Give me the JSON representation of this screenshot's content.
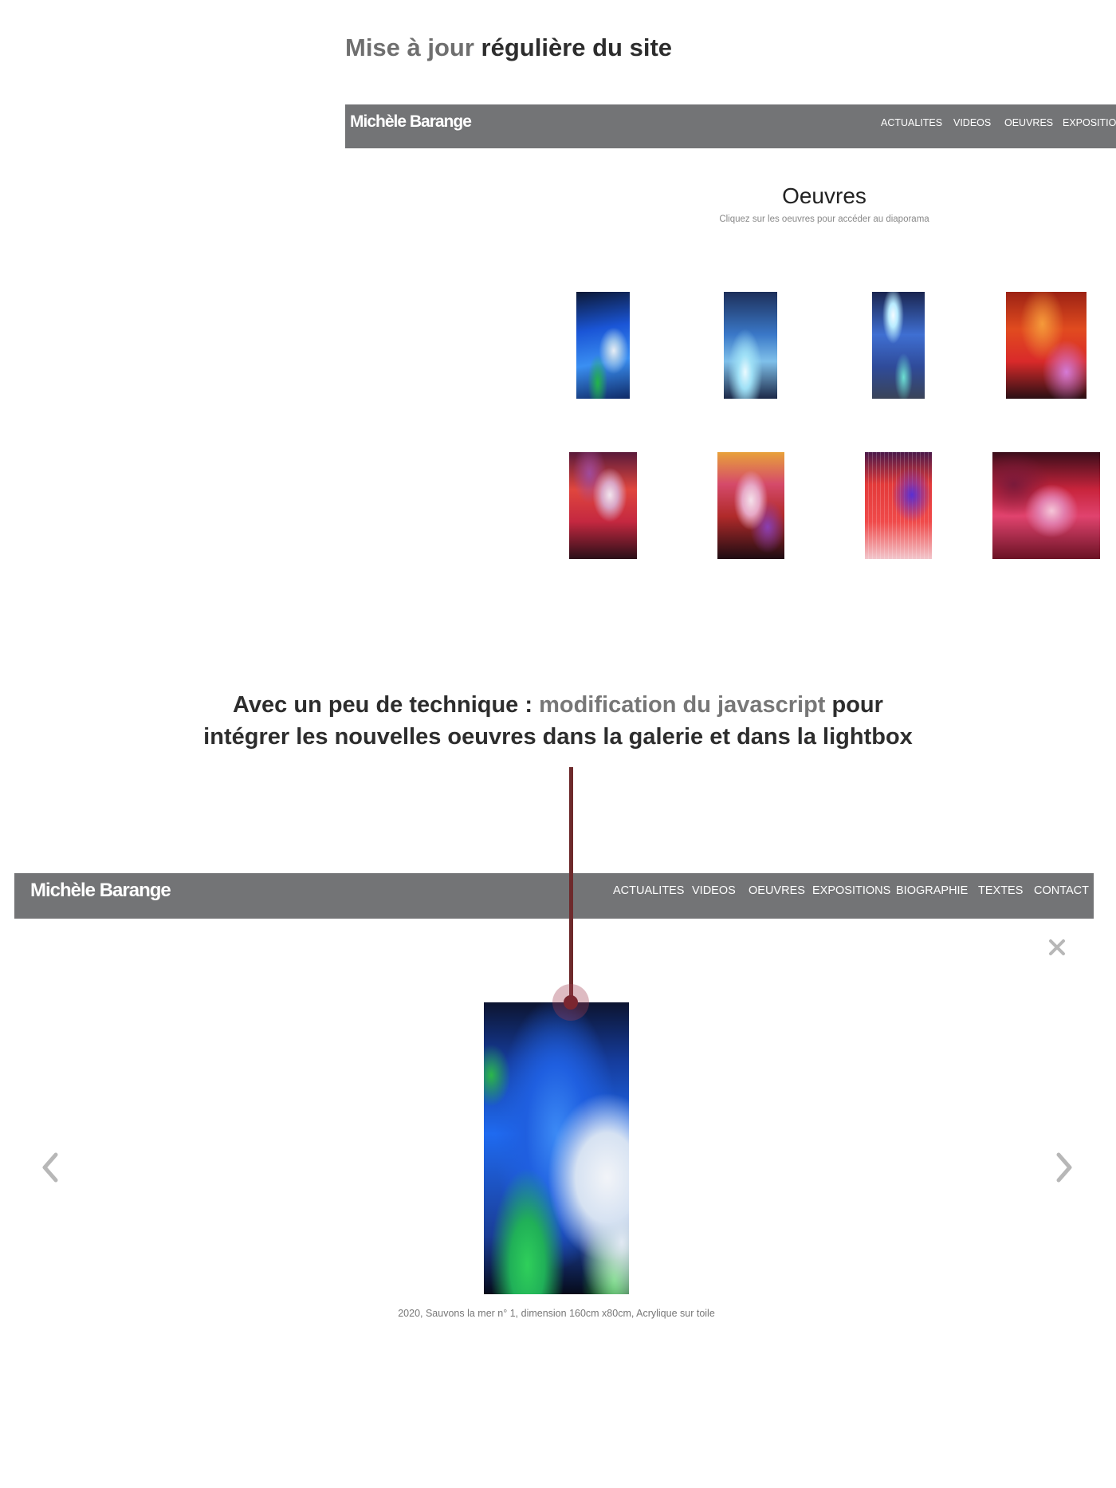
{
  "heading": {
    "accent": "Mise à jour",
    "rest": " régulière du site"
  },
  "site_top": {
    "brand": "Michèle Barange",
    "nav": [
      "ACTUALITES",
      "VIDEOS",
      "OEUVRES",
      "EXPOSITION"
    ]
  },
  "gallery": {
    "title": "Oeuvres",
    "subtitle": "Cliquez sur les oeuvres pour accéder au diaporama"
  },
  "annotation": {
    "part1": "Avec un peu de technique : ",
    "accent": "modification du javascript",
    "part2": " pour",
    "line2": "intégrer les nouvelles oeuvres dans la galerie et dans la lightbox"
  },
  "site_bottom": {
    "brand": "Michèle Barange",
    "nav": [
      "ACTUALITES",
      "VIDEOS",
      "OEUVRES",
      "EXPOSITIONS",
      "BIOGRAPHIE",
      "TEXTES",
      "CONTACT"
    ]
  },
  "lightbox": {
    "caption": "2020, Sauvons la mer n° 1, dimension 160cm x80cm, Acrylique sur toile",
    "close_icon": "close-icon",
    "prev_icon": "chevron-left-icon",
    "next_icon": "chevron-right-icon"
  },
  "colors": {
    "navbar": "#737476",
    "connector": "#6e2a2c",
    "accent_text": "#6f6f6f"
  }
}
